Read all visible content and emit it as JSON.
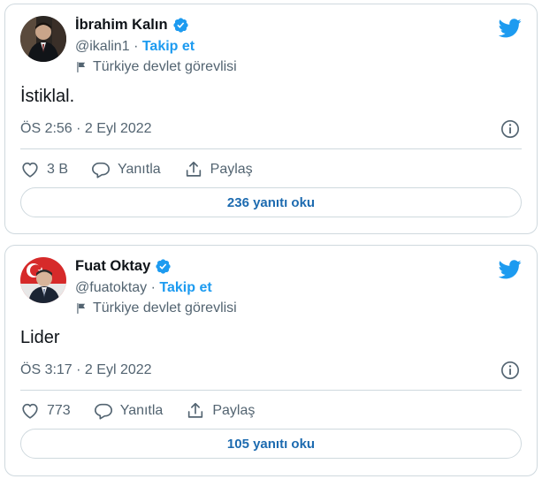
{
  "colors": {
    "accent": "#1d9bf0",
    "border": "#cfd9de",
    "secondary_text": "#536471",
    "primary_text": "#0f1419"
  },
  "tweets": [
    {
      "author": {
        "name": "İbrahim Kalın",
        "handle": "@ikalin1",
        "verified": true,
        "label": "Türkiye devlet görevlisi",
        "avatar_icon": "person-portrait-icon"
      },
      "follow_label": "Takip et",
      "separator": "·",
      "text": "İstiklal.",
      "timestamp": "ÖS 2:56 · 2 Eyl 2022",
      "likes": "3 B",
      "reply_label": "Yanıtla",
      "share_label": "Paylaş",
      "read_replies_label": "236 yanıtı oku"
    },
    {
      "author": {
        "name": "Fuat Oktay",
        "handle": "@fuatoktay",
        "verified": true,
        "label": "Türkiye devlet görevlisi",
        "avatar_icon": "person-flag-portrait-icon"
      },
      "follow_label": "Takip et",
      "separator": "·",
      "text": "Lider",
      "timestamp": "ÖS 3:17 · 2 Eyl 2022",
      "likes": "773",
      "reply_label": "Yanıtla",
      "share_label": "Paylaş",
      "read_replies_label": "105 yanıtı oku"
    }
  ]
}
